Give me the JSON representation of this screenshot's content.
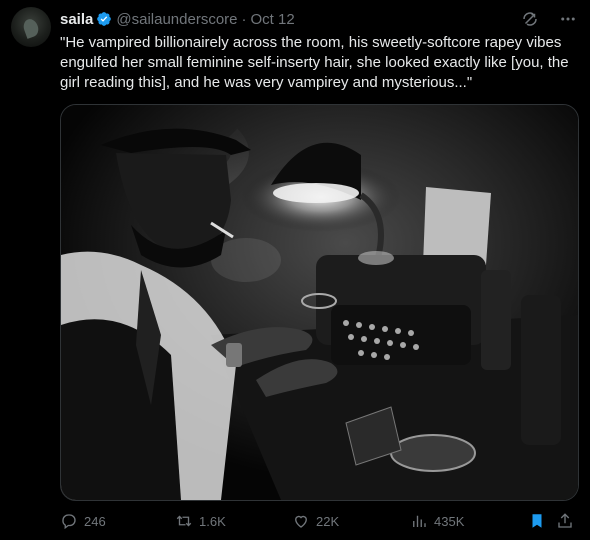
{
  "author": {
    "name": "saila",
    "handle": "@sailaunderscore",
    "separator": "·",
    "date": "Oct 12",
    "verified": true
  },
  "tweet": {
    "text": "\"He vampired billionairely across the room, his sweetly-softcore rapey vibes engulfed her small feminine self-inserty hair, she looked exactly like [you, the girl reading this], and he was very vampirey and mysterious...\""
  },
  "media": {
    "description_icon": "photo"
  },
  "actions": {
    "replies": "246",
    "retweets": "1.6K",
    "likes": "22K",
    "views": "435K"
  },
  "colors": {
    "background": "#000000",
    "text": "#e7e9ea",
    "muted": "#71767b",
    "accent": "#1d9bf0"
  }
}
